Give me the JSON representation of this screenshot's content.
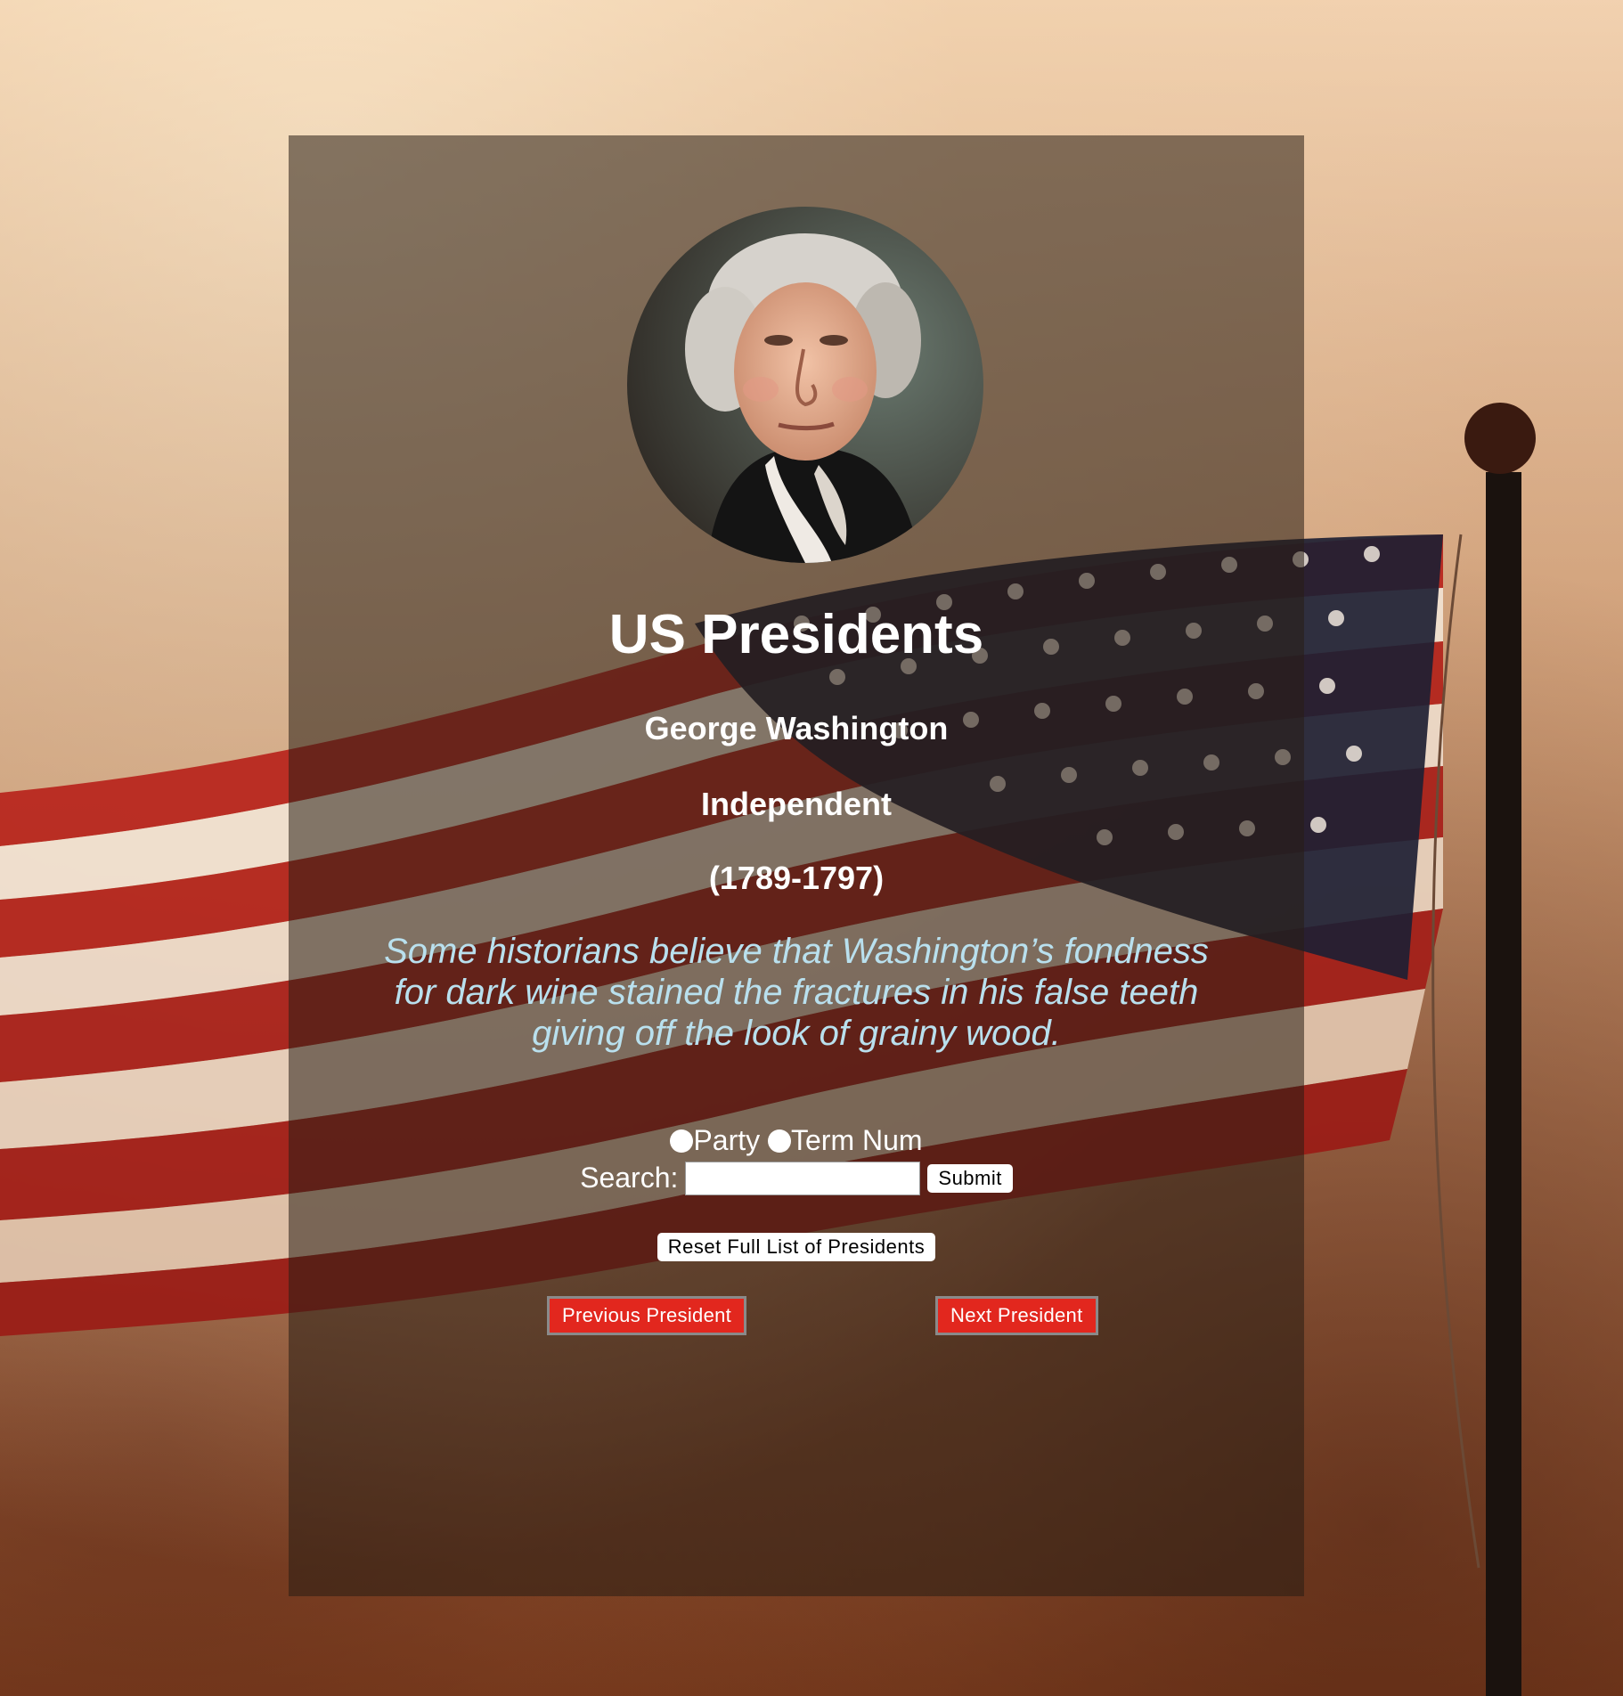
{
  "header": {
    "title": "US Presidents"
  },
  "president": {
    "name": "George Washington",
    "party": "Independent",
    "term": "(1789-1797)",
    "fact": "Some historians believe that Washington’s fondness for dark wine stained the fractures in his false teeth giving off the look of grainy wood."
  },
  "filters": {
    "options": [
      {
        "label": "Party",
        "selected": false
      },
      {
        "label": "Term Num",
        "selected": false
      }
    ]
  },
  "search": {
    "label": "Search:",
    "value": "",
    "submit_label": "Submit"
  },
  "actions": {
    "reset_label": "Reset Full List of Presidents",
    "previous_label": "Previous President",
    "next_label": "Next President"
  },
  "colors": {
    "accent_red": "#e2271e",
    "fact_text": "#b9e0ee",
    "panel": "rgba(40, 30, 20, 0.55)"
  }
}
